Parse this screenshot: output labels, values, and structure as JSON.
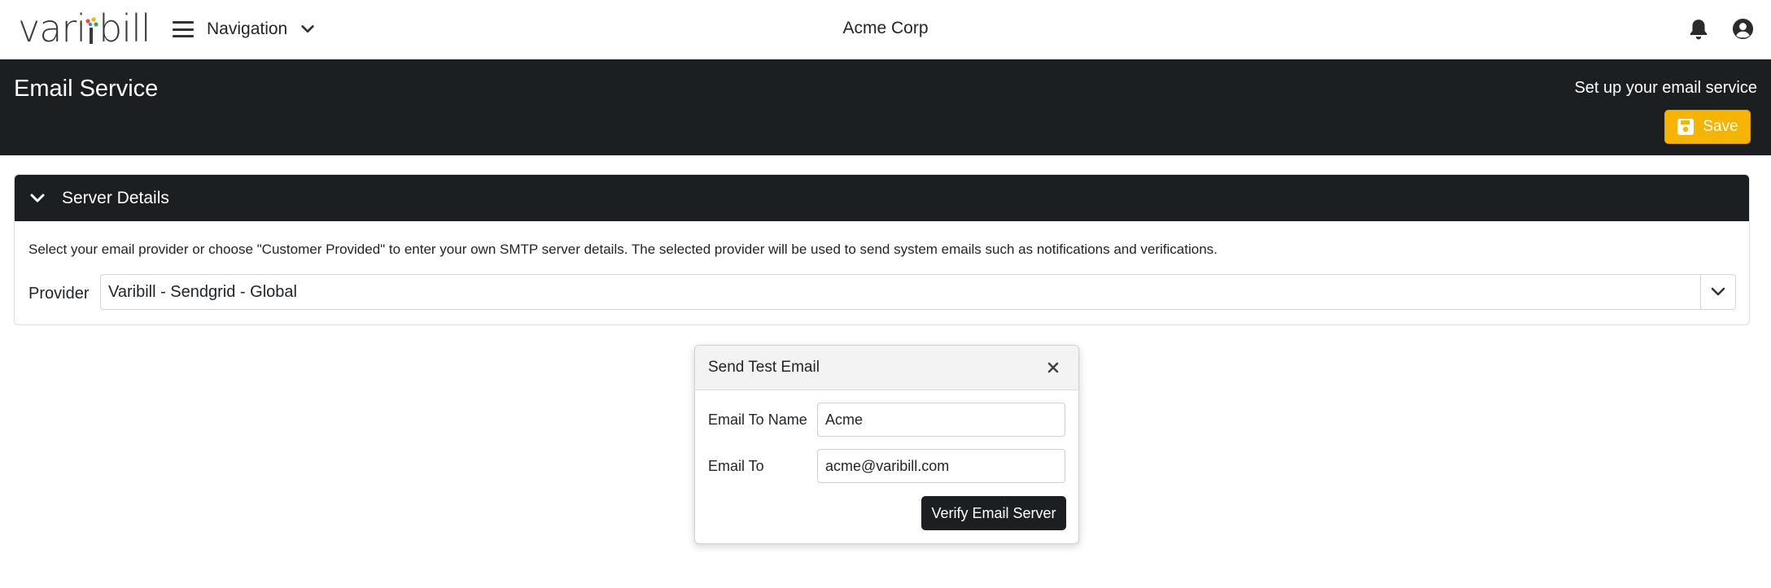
{
  "brand": {
    "logo_prefix": "vari",
    "logo_suffix": "bill",
    "logo_dot_colors": [
      "#e94b3c",
      "#f4b400",
      "#34a853",
      "#4285f4"
    ]
  },
  "topbar": {
    "nav_label": "Navigation",
    "company": "Acme Corp",
    "icons": {
      "menu": "hamburger-icon",
      "nav_chevron": "chevron-down-icon",
      "notifications": "bell-icon",
      "account": "user-circle-icon"
    }
  },
  "page_header": {
    "title": "Email Service",
    "subtitle": "Set up your email service",
    "save_label": "Save",
    "save_icon": "floppy-disk-icon",
    "save_color": "#f4b400"
  },
  "server_details": {
    "title": "Server Details",
    "description": "Select your email provider or choose \"Customer Provided\" to enter your own SMTP server details. The selected provider will be used to send system emails such as notifications and verifications.",
    "provider_label": "Provider",
    "provider_value": "Varibill - Sendgrid - Global"
  },
  "test_email_modal": {
    "title": "Send Test Email",
    "email_to_name_label": "Email To Name",
    "email_to_name_value": "Acme",
    "email_to_label": "Email To",
    "email_to_value": "acme@varibill.com",
    "verify_label": "Verify Email Server"
  },
  "theme": {
    "dark": "#1c1f22",
    "accent": "#f4b400"
  }
}
